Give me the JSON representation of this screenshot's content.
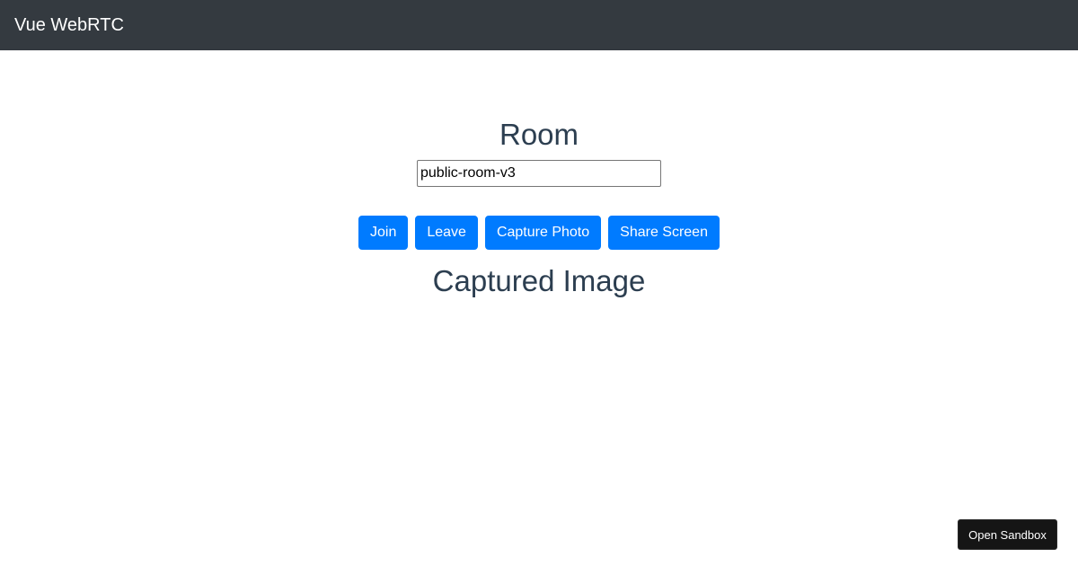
{
  "navbar": {
    "brand": "Vue WebRTC",
    "background": "#343a40"
  },
  "room": {
    "heading": "Room",
    "input_value": "public-room-v3"
  },
  "actions": {
    "join": "Join",
    "leave": "Leave",
    "capture_photo": "Capture Photo",
    "share_screen": "Share Screen",
    "button_color": "#007bff"
  },
  "captured": {
    "heading": "Captured Image"
  },
  "sandbox": {
    "label": "Open Sandbox"
  },
  "colors": {
    "heading_text": "#2c3e50"
  }
}
